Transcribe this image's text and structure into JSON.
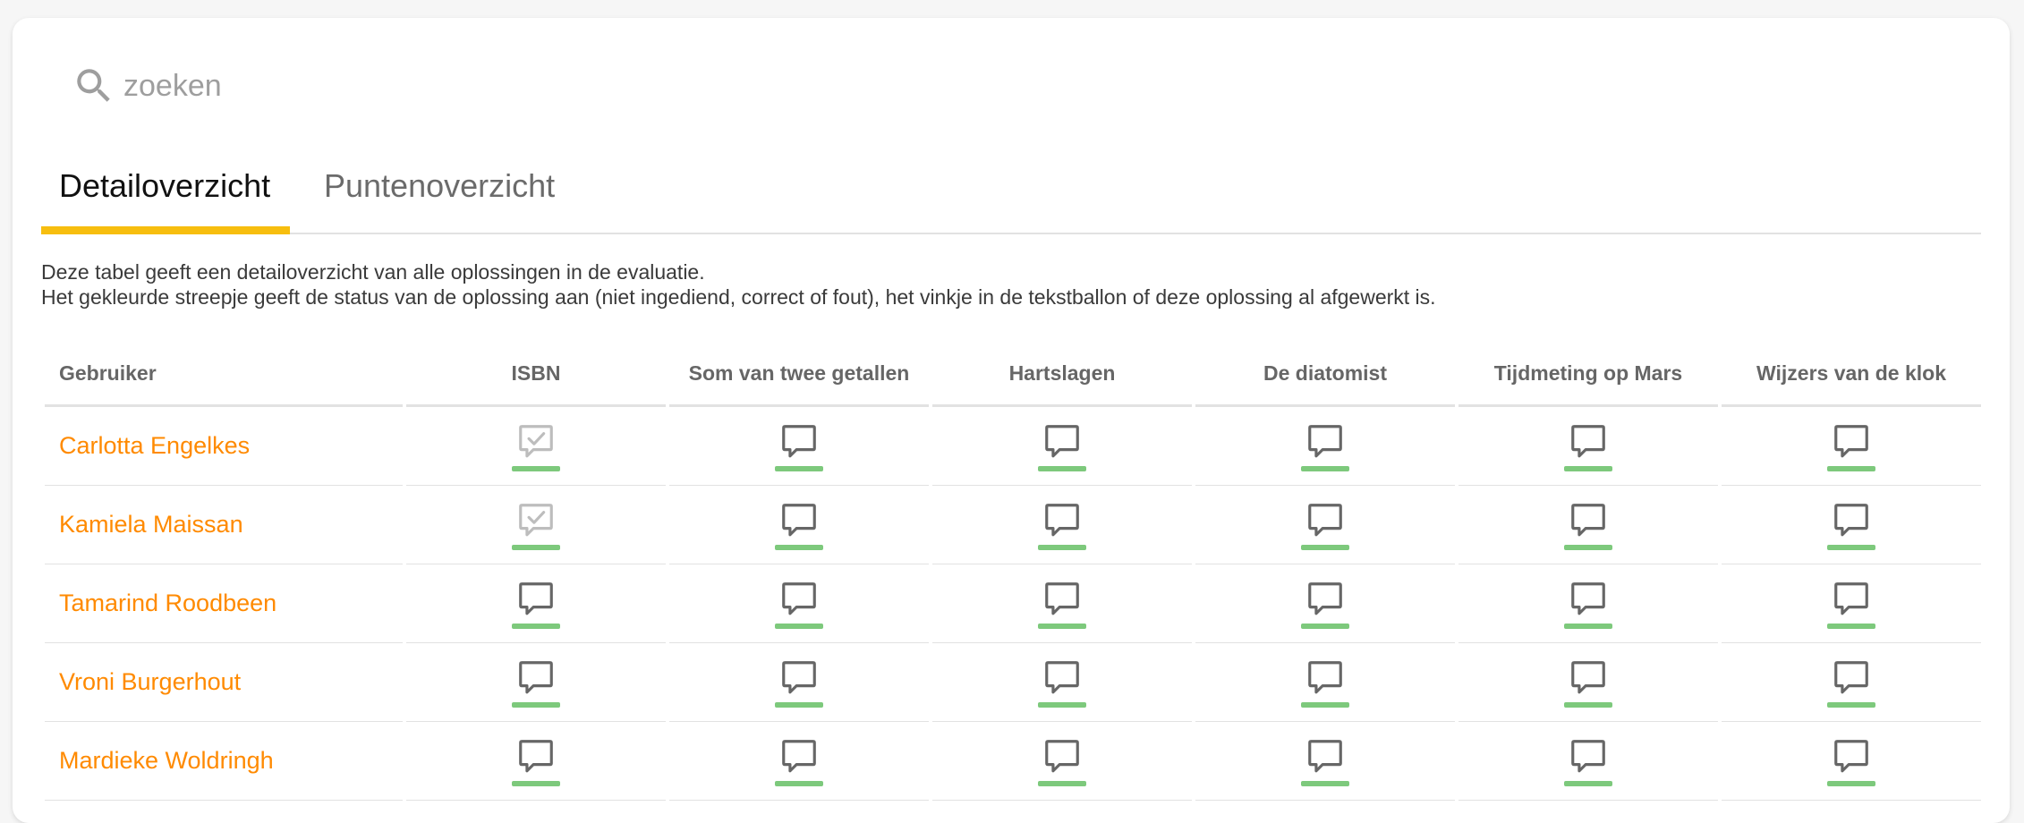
{
  "search": {
    "placeholder": "zoeken",
    "value": ""
  },
  "tabs": [
    {
      "label": "Detailoverzicht",
      "active": true
    },
    {
      "label": "Puntenoverzicht",
      "active": false
    }
  ],
  "description": {
    "line1": "Deze tabel geeft een detailoverzicht van alle oplossingen in de evaluatie.",
    "line2": "Het gekleurde streepje geeft de status van de oplossing aan (niet ingediend, correct of fout), het vinkje in de tekstballon of deze oplossing al afgewerkt is."
  },
  "colors": {
    "accent_tab": "#f7be0f",
    "user_link": "#ff8a00",
    "status_correct": "#7dc97c",
    "icon_default": "#666666",
    "icon_done": "#bdbdbd"
  },
  "table": {
    "columns": [
      "Gebruiker",
      "ISBN",
      "Som van twee getallen",
      "Hartslagen",
      "De diatomist",
      "Tijdmeting op Mars",
      "Wijzers van de klok"
    ],
    "rows": [
      {
        "user": "Carlotta Engelkes",
        "cells": [
          {
            "icon": "speech-bubble-check-icon",
            "status": "correct"
          },
          {
            "icon": "speech-bubble-icon",
            "status": "correct"
          },
          {
            "icon": "speech-bubble-icon",
            "status": "correct"
          },
          {
            "icon": "speech-bubble-icon",
            "status": "correct"
          },
          {
            "icon": "speech-bubble-icon",
            "status": "correct"
          },
          {
            "icon": "speech-bubble-icon",
            "status": "correct"
          }
        ]
      },
      {
        "user": "Kamiela Maissan",
        "cells": [
          {
            "icon": "speech-bubble-check-icon",
            "status": "correct"
          },
          {
            "icon": "speech-bubble-icon",
            "status": "correct"
          },
          {
            "icon": "speech-bubble-icon",
            "status": "correct"
          },
          {
            "icon": "speech-bubble-icon",
            "status": "correct"
          },
          {
            "icon": "speech-bubble-icon",
            "status": "correct"
          },
          {
            "icon": "speech-bubble-icon",
            "status": "correct"
          }
        ]
      },
      {
        "user": "Tamarind Roodbeen",
        "cells": [
          {
            "icon": "speech-bubble-icon",
            "status": "correct"
          },
          {
            "icon": "speech-bubble-icon",
            "status": "correct"
          },
          {
            "icon": "speech-bubble-icon",
            "status": "correct"
          },
          {
            "icon": "speech-bubble-icon",
            "status": "correct"
          },
          {
            "icon": "speech-bubble-icon",
            "status": "correct"
          },
          {
            "icon": "speech-bubble-icon",
            "status": "correct"
          }
        ]
      },
      {
        "user": "Vroni Burgerhout",
        "cells": [
          {
            "icon": "speech-bubble-icon",
            "status": "correct"
          },
          {
            "icon": "speech-bubble-icon",
            "status": "correct"
          },
          {
            "icon": "speech-bubble-icon",
            "status": "correct"
          },
          {
            "icon": "speech-bubble-icon",
            "status": "correct"
          },
          {
            "icon": "speech-bubble-icon",
            "status": "correct"
          },
          {
            "icon": "speech-bubble-icon",
            "status": "correct"
          }
        ]
      },
      {
        "user": "Mardieke Woldringh",
        "cells": [
          {
            "icon": "speech-bubble-icon",
            "status": "correct"
          },
          {
            "icon": "speech-bubble-icon",
            "status": "correct"
          },
          {
            "icon": "speech-bubble-icon",
            "status": "correct"
          },
          {
            "icon": "speech-bubble-icon",
            "status": "correct"
          },
          {
            "icon": "speech-bubble-icon",
            "status": "correct"
          },
          {
            "icon": "speech-bubble-icon",
            "status": "correct"
          }
        ]
      }
    ]
  }
}
